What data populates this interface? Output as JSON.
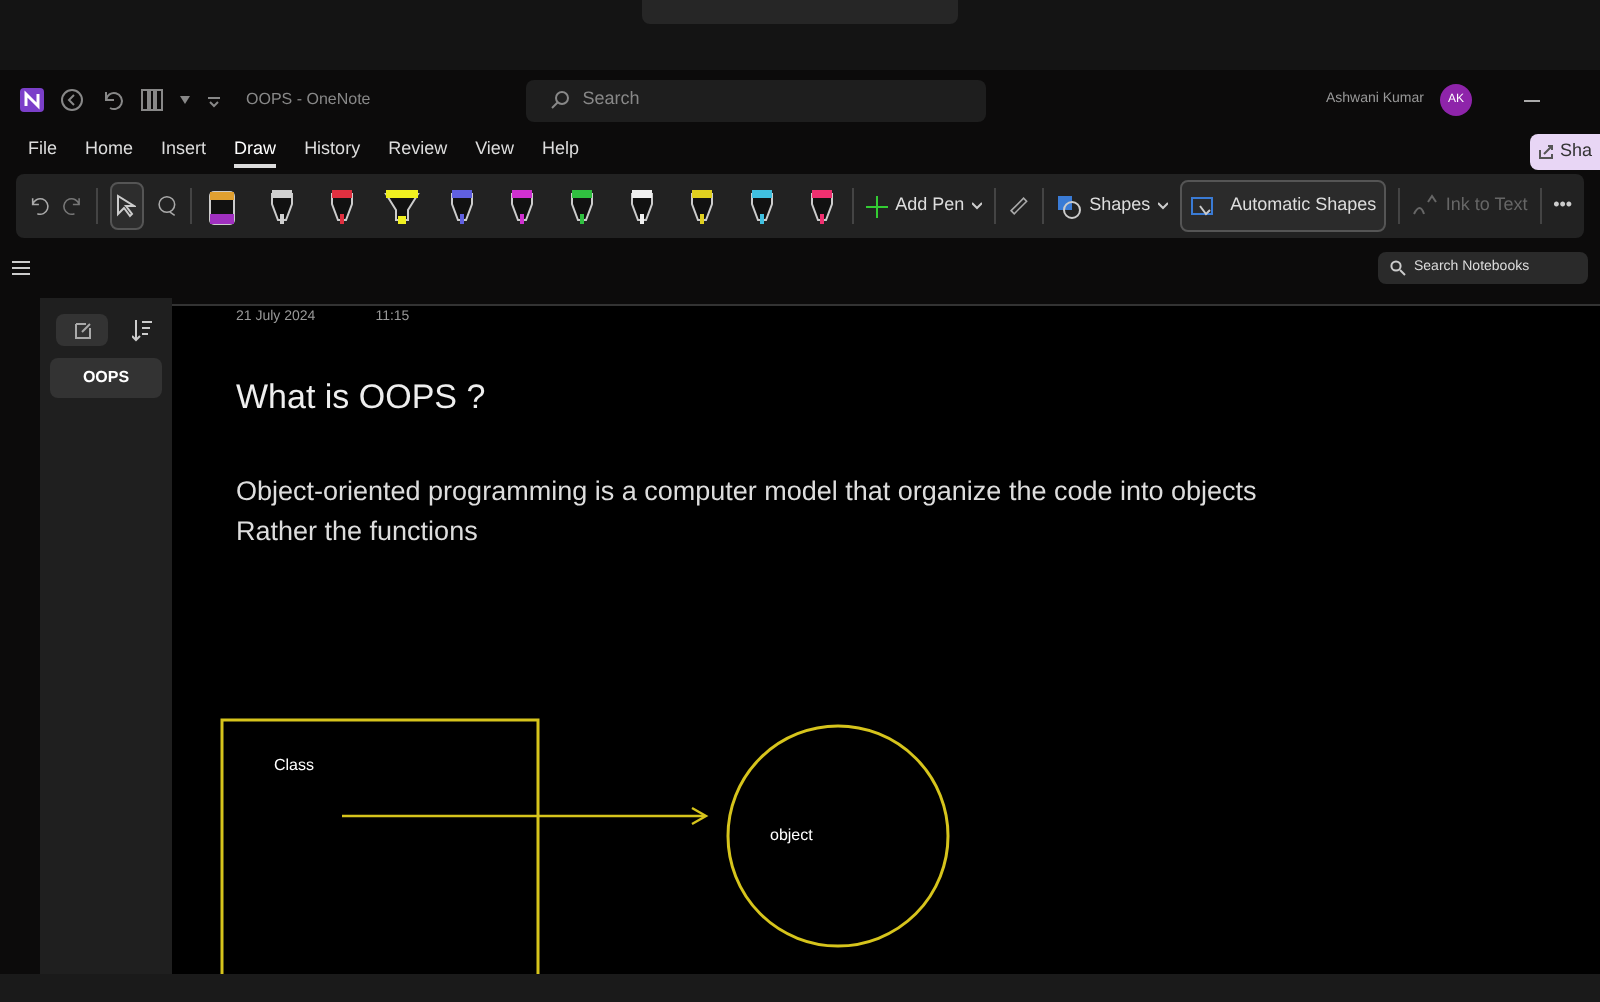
{
  "window": {
    "title": "OOPS - OneNote",
    "search_placeholder": "Search",
    "user_name": "Ashwani Kumar",
    "user_initials": "AK"
  },
  "menu": [
    {
      "label": "File",
      "selected": false
    },
    {
      "label": "Home",
      "selected": false
    },
    {
      "label": "Insert",
      "selected": false
    },
    {
      "label": "Draw",
      "selected": true
    },
    {
      "label": "History",
      "selected": false
    },
    {
      "label": "Review",
      "selected": false
    },
    {
      "label": "View",
      "selected": false
    },
    {
      "label": "Help",
      "selected": false
    }
  ],
  "share_label": "Sha",
  "toolbar": {
    "pens": [
      {
        "kind": "pencil",
        "color": "#a030c0"
      },
      {
        "kind": "pen",
        "color": "#d0d0d0"
      },
      {
        "kind": "pen",
        "color": "#e03040"
      },
      {
        "kind": "highlighter",
        "color": "#f0f020"
      },
      {
        "kind": "pen",
        "color": "#6060e0"
      },
      {
        "kind": "pen",
        "color": "#d030d0"
      },
      {
        "kind": "pen",
        "color": "#30c040"
      },
      {
        "kind": "pen",
        "color": "#f0f0f0"
      },
      {
        "kind": "pen",
        "color": "#e0d020"
      },
      {
        "kind": "pen",
        "color": "#40c0e0"
      },
      {
        "kind": "pen",
        "color": "#f03070"
      }
    ],
    "add_pen": "Add Pen",
    "shapes": "Shapes",
    "automatic_shapes": "Automatic Shapes",
    "ink_to_text": "Ink to Text",
    "more": "•••"
  },
  "search_notebooks": "Search Notebooks",
  "pages": [
    {
      "title": "OOPS",
      "selected": true
    }
  ],
  "page": {
    "date": "21 July 2024",
    "time": "11:15",
    "title": "What is OOPS ?",
    "body": [
      "Object-oriented programming is a computer model that organize the code into objects",
      "Rather the functions"
    ],
    "drawing_labels": [
      "Class",
      "object"
    ]
  }
}
